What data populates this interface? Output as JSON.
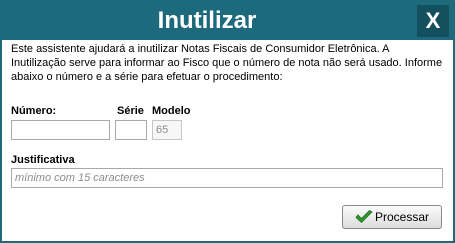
{
  "dialog": {
    "title": "Inutilizar",
    "close_label": "X",
    "intro": "Este assistente ajudará a inutilizar Notas Fiscais de Consumidor Eletrônica. A Inutilização serve para informar ao Fisco que o número de nota não será usado. Informe abaixo o número e a série para efetuar o procedimento:",
    "numero_label": "Número:",
    "numero_value": "",
    "serie_label": "Série",
    "serie_value": "",
    "modelo_label": "Modelo",
    "modelo_value": "65",
    "justificativa_label": "Justificativa",
    "justificativa_placeholder": "mínimo com 15 caracteres",
    "process_label": "Processar"
  },
  "colors": {
    "titlebar": "#1d6a7c",
    "close_box": "#144f5e",
    "check_icon": "#2e9a2e"
  },
  "icons": {
    "close": "close-icon",
    "process": "check-icon"
  }
}
